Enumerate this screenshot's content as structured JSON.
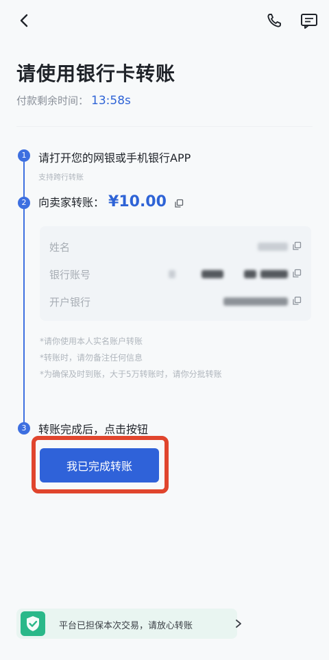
{
  "header": {
    "title": "请使用银行卡转账",
    "timer_label": "付款剩余时间：",
    "timer_value": "13:58s"
  },
  "steps": [
    {
      "number": "1",
      "title": "请打开您的网银或手机银行APP",
      "subtitle": "支持跨行转账"
    },
    {
      "number": "2",
      "title": "向卖家转账：",
      "amount": "¥10.00"
    },
    {
      "number": "3",
      "title": "转账完成后，点击按钮"
    }
  ],
  "account_card": {
    "rows": [
      {
        "label": "姓名"
      },
      {
        "label": "银行账号"
      },
      {
        "label": "开户银行"
      }
    ]
  },
  "notes": [
    "*请你使用本人实名账户转账",
    "*转账时，请勿备注任何信息",
    "*为确保及时到账，大于5万转账时，请你分批转账"
  ],
  "action": {
    "confirm_label": "我已完成转账"
  },
  "footer": {
    "guarantee_text": "平台已担保本次交易，请放心转账"
  },
  "colors": {
    "accent": "#2f62d9",
    "highlight_frame": "#e0452d",
    "guarantee_green": "#2ab889"
  }
}
